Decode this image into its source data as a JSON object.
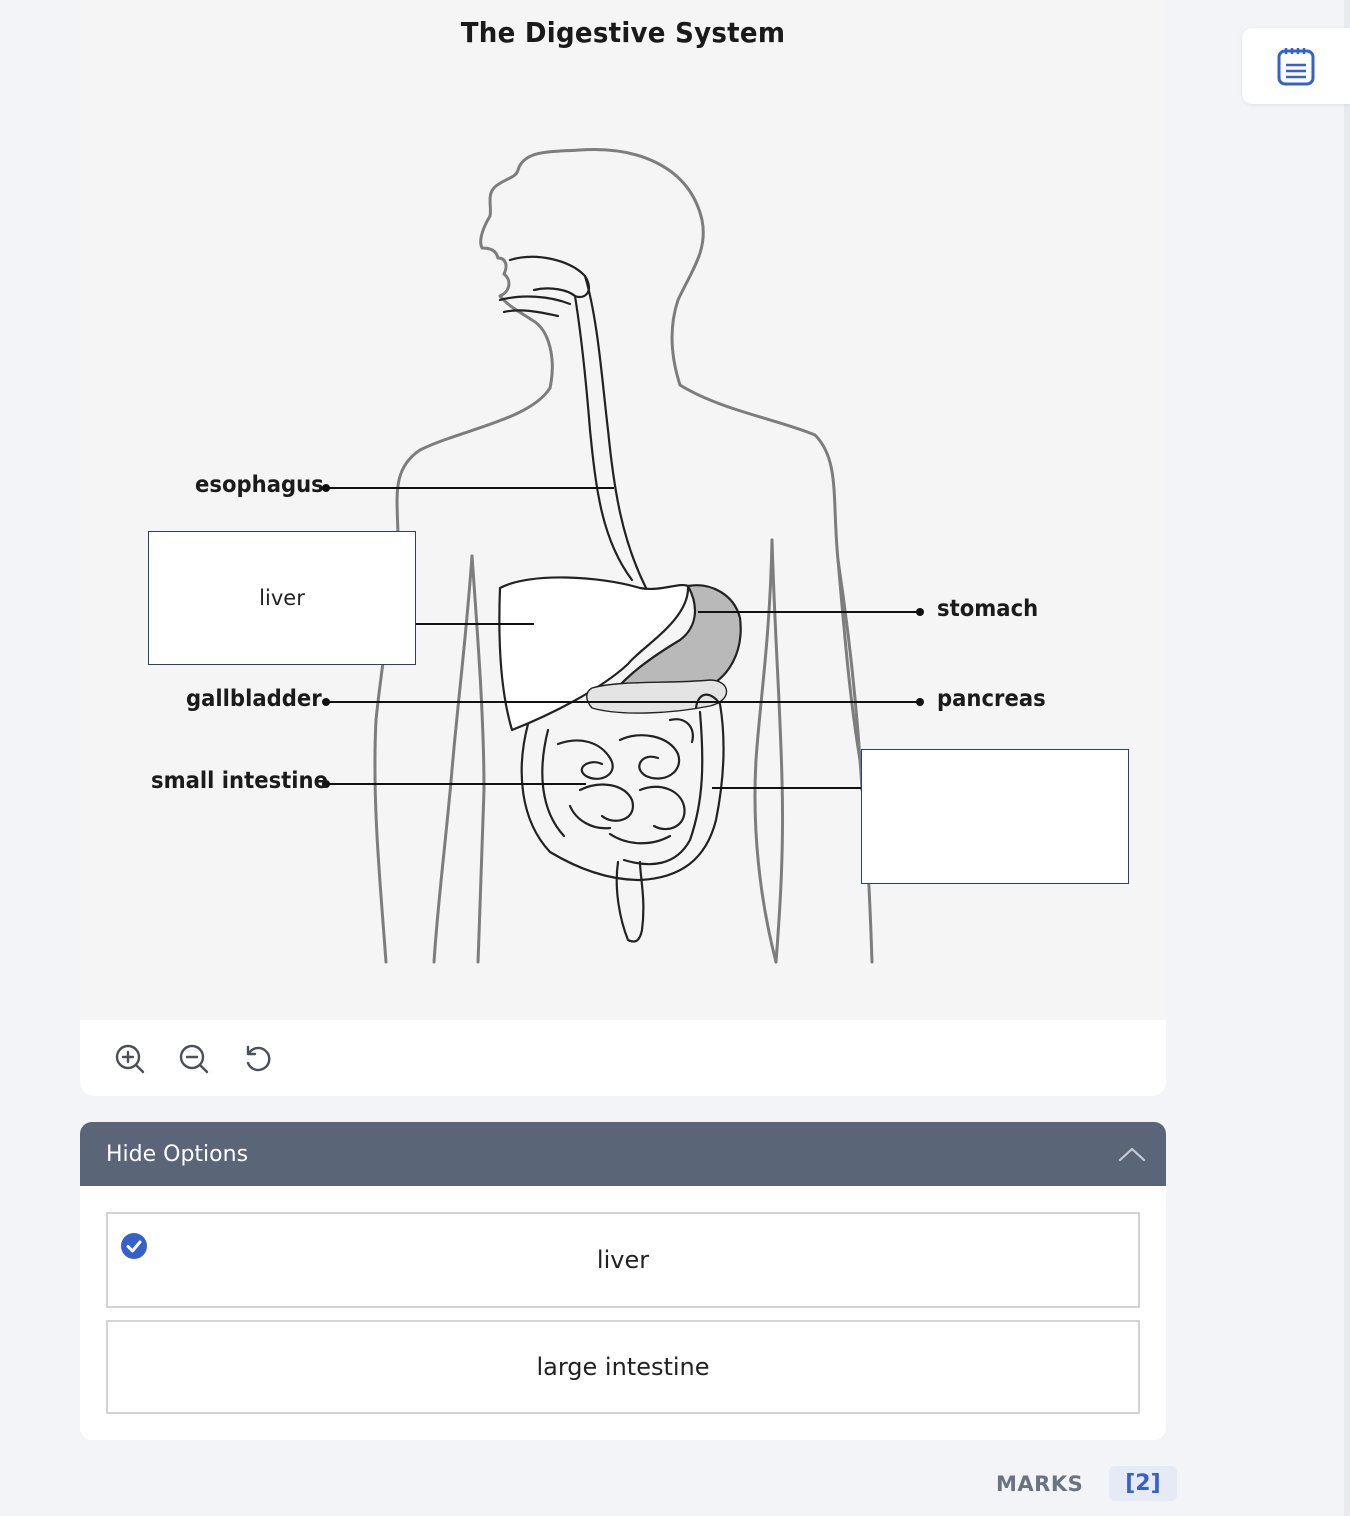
{
  "diagram": {
    "title": "The Digestive System",
    "labels": {
      "esophagus": "esophagus",
      "gallbladder": "gallbladder",
      "small_intestine": "small intestine",
      "stomach": "stomach",
      "pancreas": "pancreas"
    },
    "dropzones": {
      "left": "liver",
      "right": ""
    }
  },
  "toolbar": {
    "icons": [
      "zoom-in-icon",
      "zoom-out-icon",
      "reset-icon"
    ]
  },
  "options_panel": {
    "header": "Hide Options",
    "items": [
      {
        "label": "liver",
        "selected": true
      },
      {
        "label": "large intestine",
        "selected": false
      }
    ]
  },
  "marks": {
    "label": "MARKS",
    "value": "[2]"
  },
  "colors": {
    "header_bg": "#5a6578",
    "accent": "#3561c9",
    "dropzone_border": "#2a3f73"
  }
}
